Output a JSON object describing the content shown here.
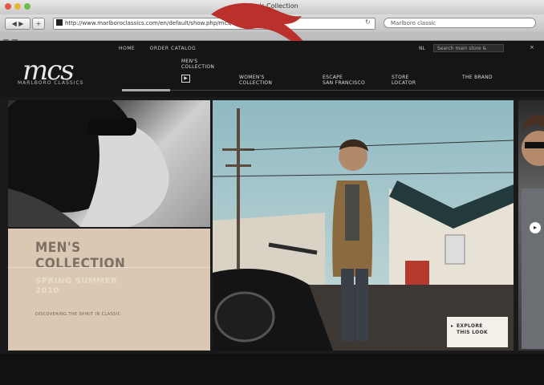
{
  "window": {
    "title": "Men's Collection",
    "url": "http://www.marlboroclassics.com/en/default/show.php/mcs/men.html",
    "search_placeholder": "Marlboro classic",
    "back_label": "◀ ▶",
    "plus_label": "+",
    "reload_label": "↻"
  },
  "site": {
    "logo": "mcs",
    "logo_sub": "MARLBORO CLASSICS",
    "top_links": [
      "HOME",
      "ORDER CATALOG"
    ],
    "lang": "NL",
    "search_placeholder": "Search main store &",
    "close_label": "×",
    "nav": [
      {
        "label": "MEN'S\nCOLLECTION"
      },
      {
        "label": "WOMEN'S\nCOLLECTION"
      },
      {
        "label": "ESCAPE\nSAN FRANCISCO"
      },
      {
        "label": "STORE\nLOCATOR"
      },
      {
        "label": "THE BRAND"
      }
    ],
    "play_label": "▶"
  },
  "collection": {
    "title_line1": "MEN'S",
    "title_line2": "COLLECTION",
    "subtitle_line1": "SPRING SUMMER",
    "subtitle_line2": "2010",
    "small_text": "DISCOVERING THE SPIRIT IN CLASSIC"
  },
  "explore": {
    "line1": "EXPLORE",
    "line2": "THIS LOOK",
    "arrow": "▸"
  },
  "next_arrow": "▸",
  "colors": {
    "page_bg": "#121212",
    "collection_bg": "#dbc8b3",
    "bird": "#b9302c"
  }
}
